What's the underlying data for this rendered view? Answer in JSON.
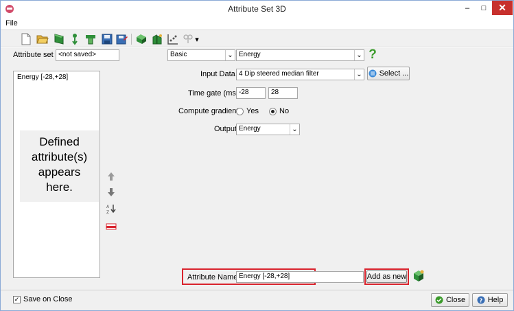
{
  "window": {
    "title": "Attribute Set 3D",
    "minimize_glyph": "–",
    "maximize_glyph": "□",
    "close_glyph": "✕"
  },
  "menu": {
    "file_label": "File"
  },
  "toolbar": {
    "icons": [
      "new-icon",
      "open-icon",
      "import-icon",
      "import-steering-icon",
      "import-other-icon",
      "save-icon",
      "save-as-icon",
      "evaluate-icon",
      "auto-load-icon",
      "cross-plot-icon",
      "more-tools-icon"
    ],
    "dropdown_glyph": "▾"
  },
  "attribute_set": {
    "label": "Attribute set",
    "value": "<not saved>"
  },
  "category_combo": {
    "value": "Basic"
  },
  "type_combo": {
    "value": "Energy"
  },
  "help_glyph": "?",
  "combo_arrow_glyph": "⌄",
  "list": {
    "items": [
      "Energy [-28,+28]"
    ],
    "placeholder_lines": [
      "Defined",
      "attribute(s)",
      "appears",
      "here."
    ]
  },
  "side_buttons": [
    "move-up-icon",
    "move-down-icon",
    "sort-icon",
    "remove-icon"
  ],
  "form": {
    "input_data_label": "Input Data",
    "input_data_value": "4 Dip steered median filter",
    "select_button": "Select ...",
    "time_gate_label": "Time gate (ms)",
    "time_gate_start": "-28",
    "time_gate_stop": "28",
    "compute_gradient_label": "Compute gradient",
    "gradient_yes": "Yes",
    "gradient_no": "No",
    "gradient_selected": "No",
    "output_label": "Output",
    "output_value": "Energy"
  },
  "attribute_name": {
    "label": "Attribute Name",
    "value": "Energy [-28,+28]",
    "add_as_new": "Add as new"
  },
  "bottom": {
    "save_on_close_label": "Save on Close",
    "save_on_close_checked": true,
    "checkmark_glyph": "✓",
    "close_label": "Close",
    "help_label": "Help"
  },
  "colors": {
    "highlight_red": "#d9232d",
    "help_green": "#3a9a2a",
    "close_red": "#c7302d"
  }
}
